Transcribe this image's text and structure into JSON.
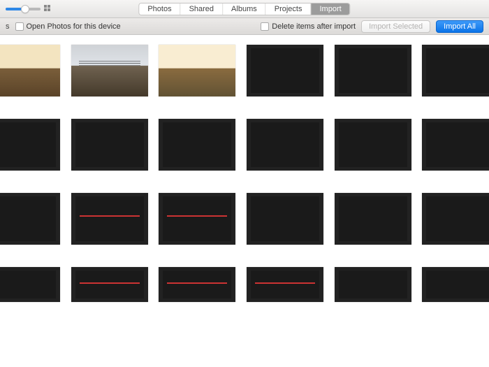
{
  "titlebar": {
    "tabs": [
      "Photos",
      "Shared",
      "Albums",
      "Projects",
      "Import"
    ],
    "active_tab_index": 4
  },
  "toolbar": {
    "left_truncated_label": "s",
    "open_photos_label": "Open Photos for this device",
    "delete_after_label": "Delete items after import",
    "import_selected_label": "Import Selected",
    "import_all_label": "Import All",
    "import_selected_enabled": false
  },
  "zoom": {
    "value": 0.45
  },
  "thumbnails": [
    {
      "kind": "land-a"
    },
    {
      "kind": "land-b"
    },
    {
      "kind": "land-c"
    },
    {
      "kind": "tv crowd-a"
    },
    {
      "kind": "tv crowd-a"
    },
    {
      "kind": "tv crowd-b"
    },
    {
      "kind": "tv crowd-a"
    },
    {
      "kind": "tv crowd-a"
    },
    {
      "kind": "tv crowd-b"
    },
    {
      "kind": "tv crowd-c"
    },
    {
      "kind": "tv crowd-b"
    },
    {
      "kind": "tv crowd-d"
    },
    {
      "kind": "tv crowd-b"
    },
    {
      "kind": "tv arena"
    },
    {
      "kind": "tv arena"
    },
    {
      "kind": "tv court"
    },
    {
      "kind": "tv court"
    },
    {
      "kind": "tv crowd-d"
    },
    {
      "kind": "tv court"
    },
    {
      "kind": "tv arena"
    },
    {
      "kind": "tv arena"
    },
    {
      "kind": "tv arena"
    },
    {
      "kind": "tv court"
    },
    {
      "kind": "tv court"
    }
  ]
}
